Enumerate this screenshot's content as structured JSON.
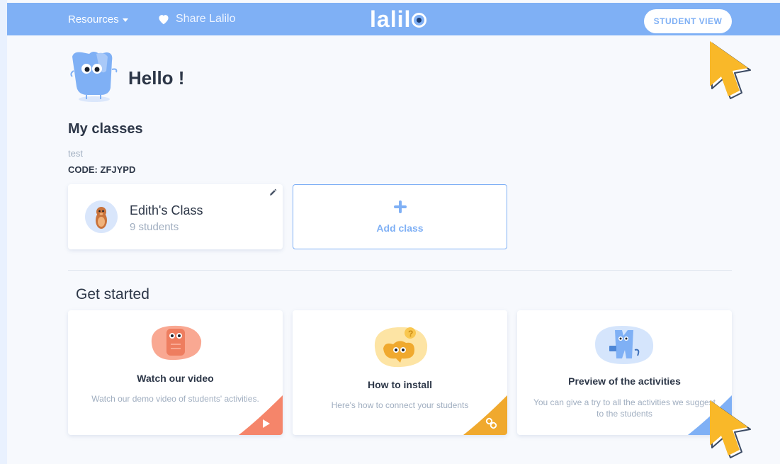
{
  "nav": {
    "resources_label": "Resources",
    "share_label": "Share Lalilo",
    "logo_text": "lalil",
    "student_view_label": "STUDENT VIEW"
  },
  "greeting": {
    "text": "Hello !"
  },
  "classes": {
    "section_title": "My classes",
    "group_name": "test",
    "code_text": "CODE: ZFJYPD",
    "items": [
      {
        "title": "Edith's Class",
        "subtitle": "9 students"
      }
    ],
    "add_label": "Add class"
  },
  "get_started": {
    "section_title": "Get started",
    "cards": [
      {
        "title": "Watch our video",
        "description": "Watch our demo video of students' activities.",
        "corner_color": "#f5856a",
        "corner_icon": "play-icon"
      },
      {
        "title": "How to install",
        "description": "Here's how to connect your students",
        "corner_color": "#f0a92e",
        "corner_icon": "link-icon"
      },
      {
        "title": "Preview of the activities",
        "description": "You can give a try to all the activities we suggest to the students",
        "corner_color": "#7fb0f5",
        "corner_icon": "eye-icon"
      }
    ]
  },
  "colors": {
    "brand_blue": "#7fb0f5",
    "text_dark": "#2d3748",
    "text_muted": "#a0aec0",
    "cursor_yellow": "#f9b829"
  },
  "icons": [
    "caret-down-icon",
    "heart-icon",
    "pencil-icon",
    "plus-icon",
    "play-icon",
    "link-icon",
    "mouse-cursor-icon"
  ]
}
